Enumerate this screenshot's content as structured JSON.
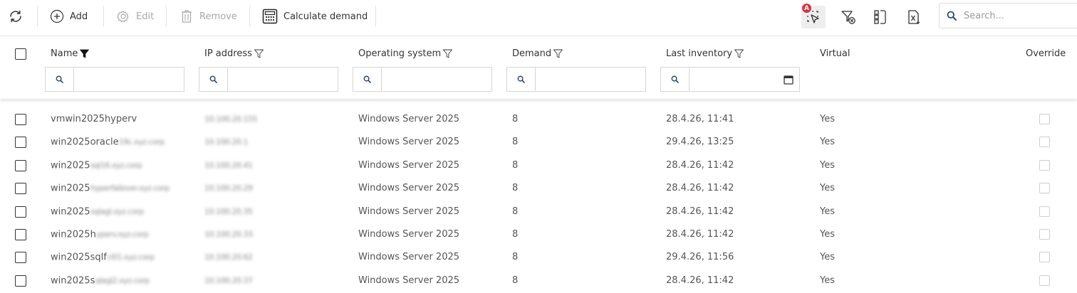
{
  "toolbar": {
    "add_label": "Add",
    "edit_label": "Edit",
    "remove_label": "Remove",
    "calculate_label": "Calculate demand",
    "search_placeholder": "Search...",
    "badge_letter": "A"
  },
  "columns": {
    "name": "Name",
    "ip": "IP address",
    "os": "Operating system",
    "demand": "Demand",
    "last_inventory": "Last inventory",
    "virtual": "Virtual",
    "override": "Override"
  },
  "rows": [
    {
      "name": "vmwin2025hyperv",
      "name_hidden": "",
      "ip_hidden": "10.100.20.155",
      "os": "Windows Server 2025",
      "demand": "8",
      "last_inventory": "28.4.26, 11:41",
      "virtual": "Yes"
    },
    {
      "name": "win2025oracle",
      "name_hidden": "19c.xyz.corp",
      "ip_hidden": "10.100.20.1",
      "os": "Windows Server 2025",
      "demand": "8",
      "last_inventory": "29.4.26, 13:25",
      "virtual": "Yes"
    },
    {
      "name": "win2025",
      "name_hidden": "sql16.xyz.corp",
      "ip_hidden": "10.100.20.41",
      "os": "Windows Server 2025",
      "demand": "8",
      "last_inventory": "28.4.26, 11:42",
      "virtual": "Yes"
    },
    {
      "name": "win2025",
      "name_hidden": "hyperfailover.xyz.corp",
      "ip_hidden": "10.100.20.29",
      "os": "Windows Server 2025",
      "demand": "8",
      "last_inventory": "28.4.26, 11:42",
      "virtual": "Yes"
    },
    {
      "name": "win2025",
      "name_hidden": "sqlagl.xyz.corp",
      "ip_hidden": "10.100.20.35",
      "os": "Windows Server 2025",
      "demand": "8",
      "last_inventory": "28.4.26, 11:42",
      "virtual": "Yes"
    },
    {
      "name": "win2025h",
      "name_hidden": "yperv.xyz.corp",
      "ip_hidden": "10.100.20.33",
      "os": "Windows Server 2025",
      "demand": "8",
      "last_inventory": "28.4.26, 11:42",
      "virtual": "Yes"
    },
    {
      "name": "win2025sqlf",
      "name_hidden": "ci01.xyz.corp",
      "ip_hidden": "10.100.20.62",
      "os": "Windows Server 2025",
      "demand": "8",
      "last_inventory": "29.4.26, 11:56",
      "virtual": "Yes"
    },
    {
      "name": "win2025s",
      "name_hidden": "qlagl2.xyz.corp",
      "ip_hidden": "10.100.20.37",
      "os": "Windows Server 2025",
      "demand": "8",
      "last_inventory": "28.4.26, 11:42",
      "virtual": "Yes"
    }
  ]
}
